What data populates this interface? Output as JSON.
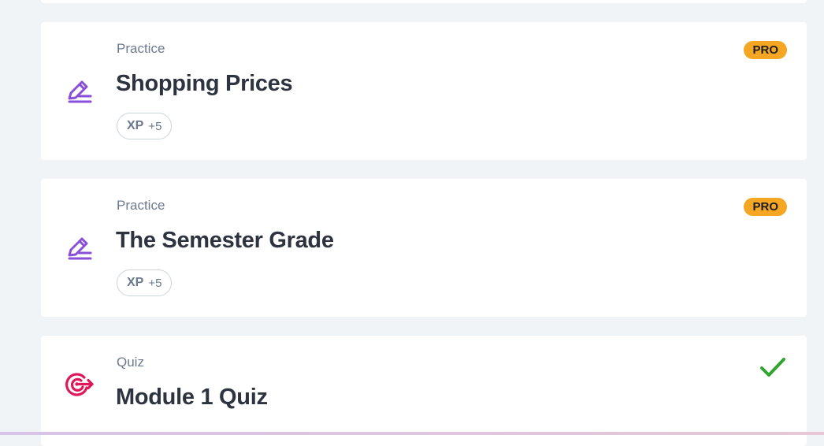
{
  "cards": [
    {
      "type": "Practice",
      "title": "Shopping Prices",
      "icon": "pencil-lines-icon",
      "xp_label": "XP",
      "xp_value": "+5",
      "badge": "PRO"
    },
    {
      "type": "Practice",
      "title": "The Semester Grade",
      "icon": "pencil-lines-icon",
      "xp_label": "XP",
      "xp_value": "+5",
      "badge": "PRO"
    },
    {
      "type": "Quiz",
      "title": "Module 1 Quiz",
      "icon": "target-arrow-icon",
      "status": "completed-check-icon"
    }
  ],
  "colors": {
    "practice_icon": "#8a4fd8",
    "quiz_icon": "#e0185a",
    "pro_badge": "#f5a623",
    "check": "#2fa52f"
  }
}
